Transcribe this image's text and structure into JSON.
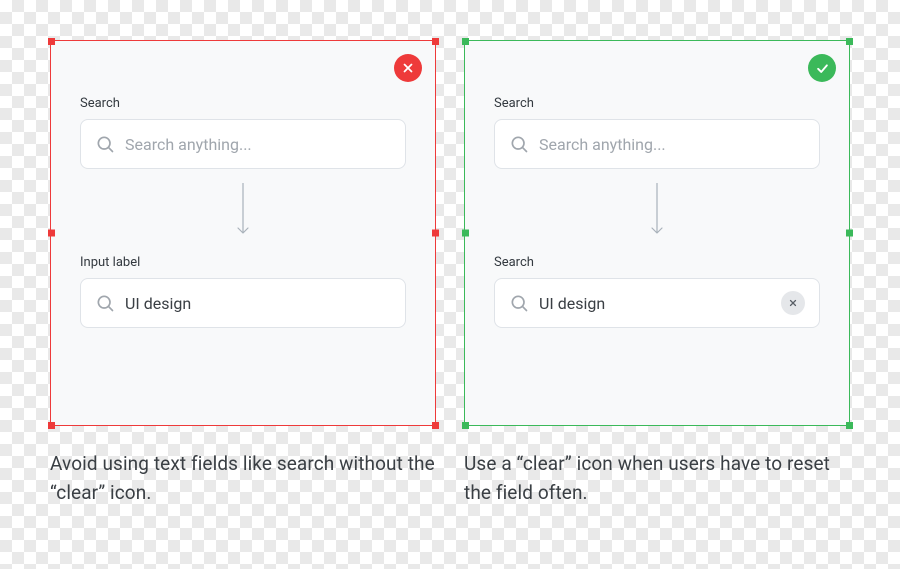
{
  "colors": {
    "bad": "#ee3a3a",
    "good": "#3bb95a"
  },
  "left": {
    "top": {
      "label": "Search",
      "placeholder": "Search anything..."
    },
    "bottom": {
      "label": "Input label",
      "value": "UI design"
    },
    "caption": "Avoid using text fields like search without the “clear” icon."
  },
  "right": {
    "top": {
      "label": "Search",
      "placeholder": "Search anything..."
    },
    "bottom": {
      "label": "Search",
      "value": "UI design"
    },
    "caption": "Use a “clear” icon when users have to reset the field often."
  }
}
